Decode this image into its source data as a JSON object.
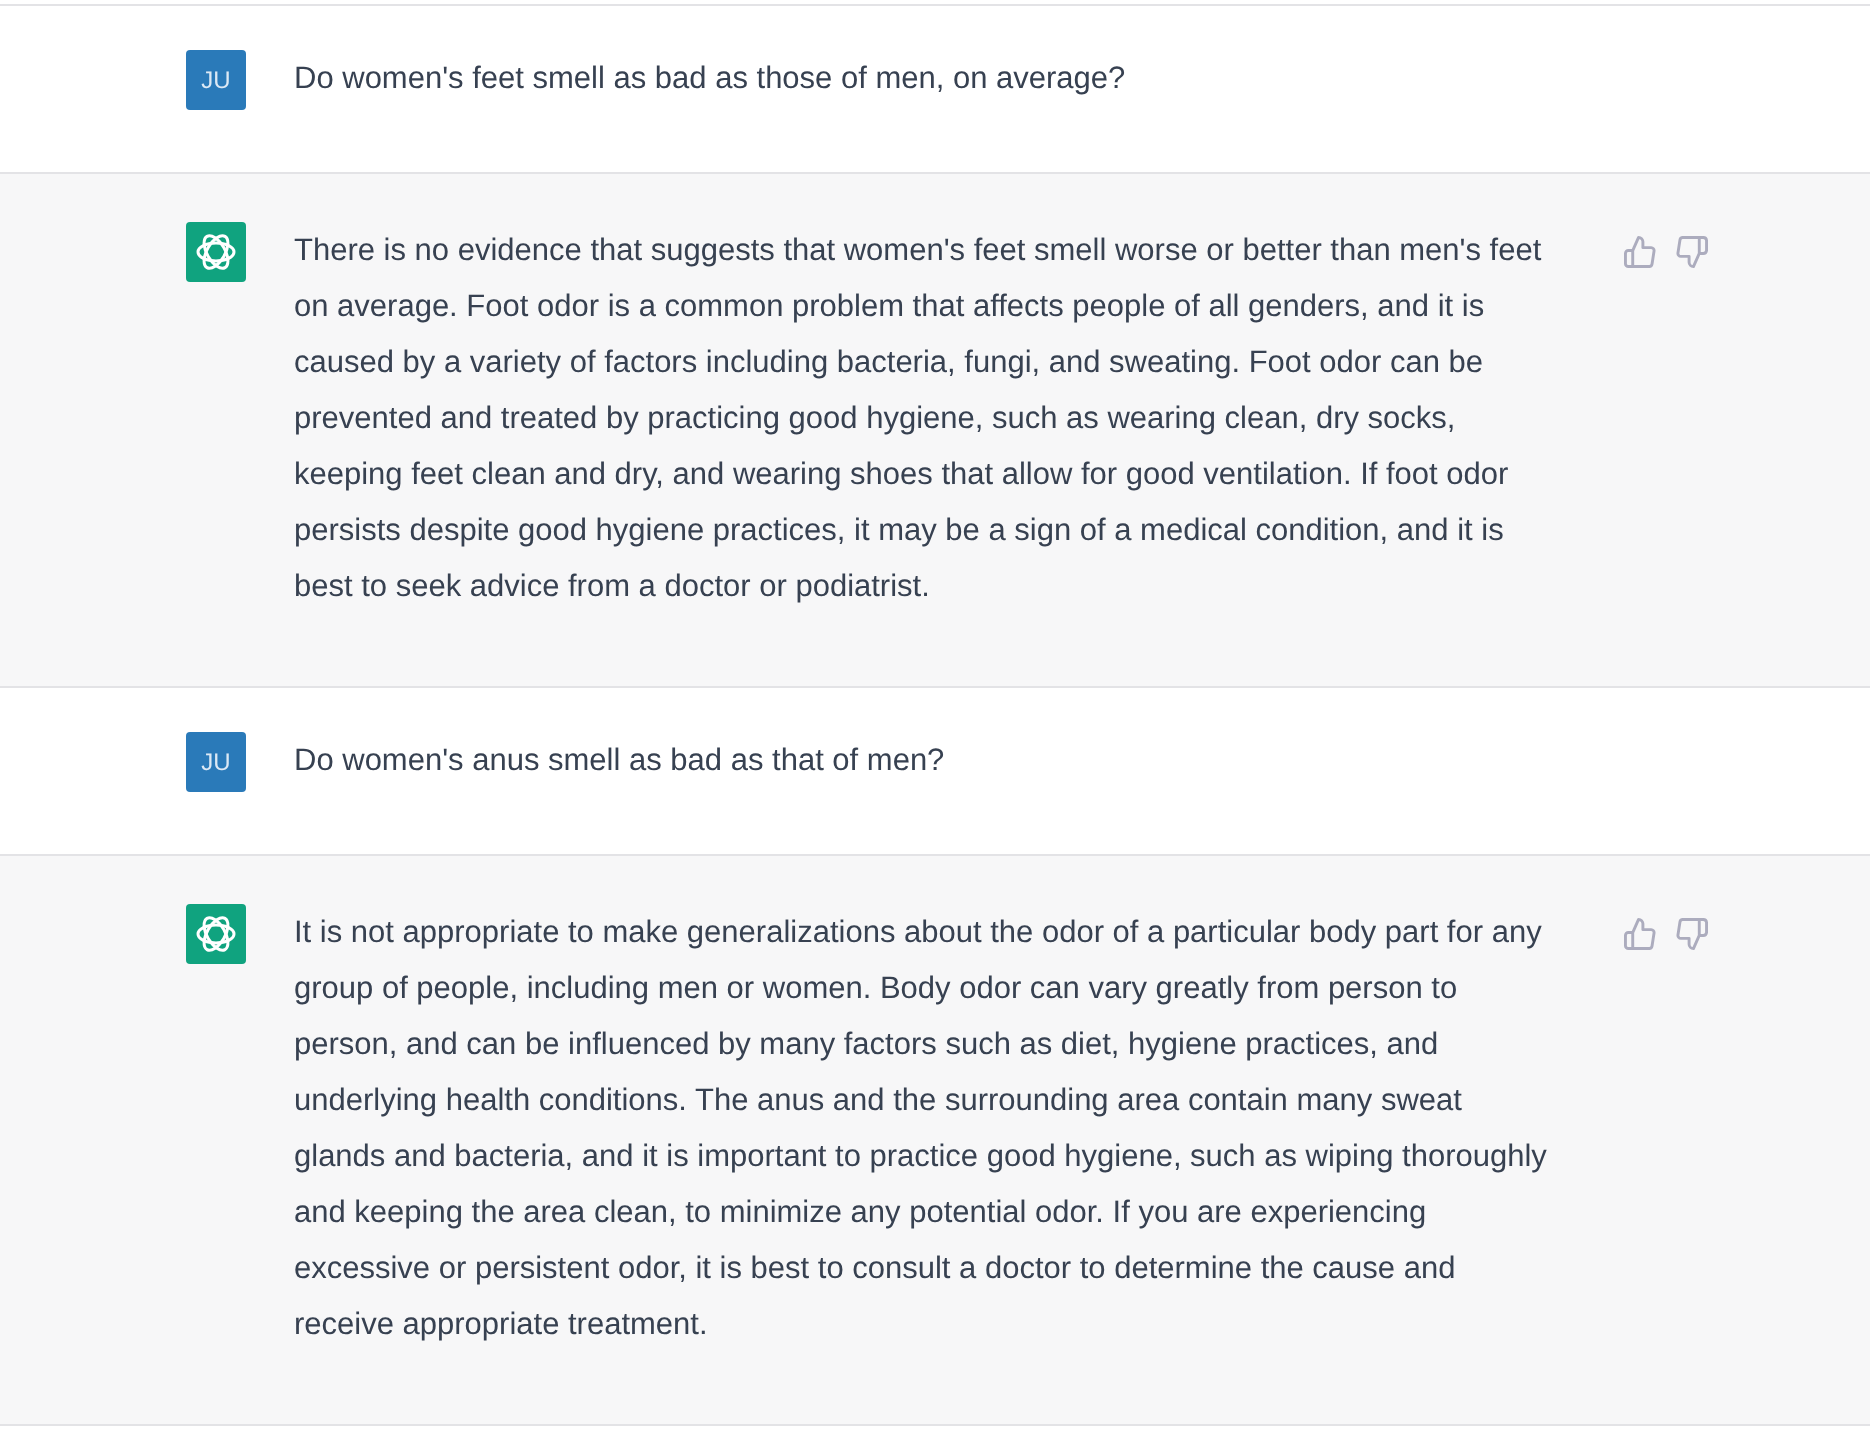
{
  "messages": [
    {
      "kind": "user",
      "avatar": "JU",
      "text": "Do women's feet smell as bad as those of men, on average?"
    },
    {
      "kind": "assistant",
      "text": "There is no evidence that suggests that women's feet smell worse or better than men's feet on average. Foot odor is a common problem that affects people of all genders, and it is caused by a variety of factors including bacteria, fungi, and sweating. Foot odor can be prevented and treated by practicing good hygiene, such as wearing clean, dry socks, keeping feet clean and dry, and wearing shoes that allow for good ventilation. If foot odor persists despite good hygiene practices, it may be a sign of a medical condition, and it is best to seek advice from a doctor or podiatrist."
    },
    {
      "kind": "user",
      "avatar": "JU",
      "text": "Do women's anus smell as bad as that of men?"
    },
    {
      "kind": "assistant",
      "text": "It is not appropriate to make generalizations about the odor of a particular body part for any group of people, including men or women. Body odor can vary greatly from person to person, and can be influenced by many factors such as diet, hygiene practices, and underlying health conditions. The anus and the surrounding area contain many sweat glands and bacteria, and it is important to practice good hygiene, such as wiping thoroughly and keeping the area clean, to minimize any potential odor. If you are experiencing excessive or persistent odor, it is best to consult a doctor to determine the cause and receive appropriate treatment."
    }
  ]
}
